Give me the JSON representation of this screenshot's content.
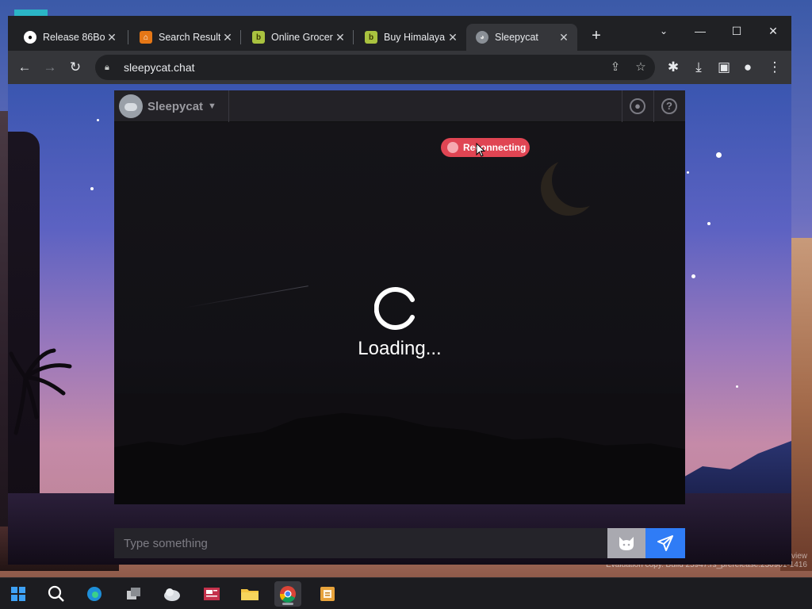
{
  "browser": {
    "tabs": [
      {
        "title": "Release 86Bo",
        "favicon": "github-icon"
      },
      {
        "title": "Search Result",
        "favicon": "store-icon"
      },
      {
        "title": "Online Grocer",
        "favicon": "bigbasket-icon"
      },
      {
        "title": "Buy Himalaya",
        "favicon": "bigbasket-icon"
      },
      {
        "title": "Sleepycat",
        "favicon": "cat-icon"
      }
    ],
    "active_tab_index": 4,
    "url": "sleepycat.chat",
    "window_controls": [
      "chevron-down-icon",
      "minimize-icon",
      "maximize-icon",
      "close-icon"
    ]
  },
  "app": {
    "brand_name": "Sleepycat",
    "status_badge": "Reconnecting",
    "loading_text": "Loading...",
    "input_placeholder": "Type something",
    "colors": {
      "badge": "#e04553",
      "send": "#2f7cf6"
    }
  },
  "desktop": {
    "watermark": "Evaluation copy. Build 25947.rs_prerelease.230901-1416",
    "watermark_prefix": "view"
  },
  "taskbar": {
    "items": [
      "windows-start-icon",
      "search-icon",
      "edge-icon",
      "task-view-icon",
      "weather-icon",
      "news-icon",
      "file-explorer-icon",
      "chrome-icon",
      "notepad-icon"
    ]
  }
}
